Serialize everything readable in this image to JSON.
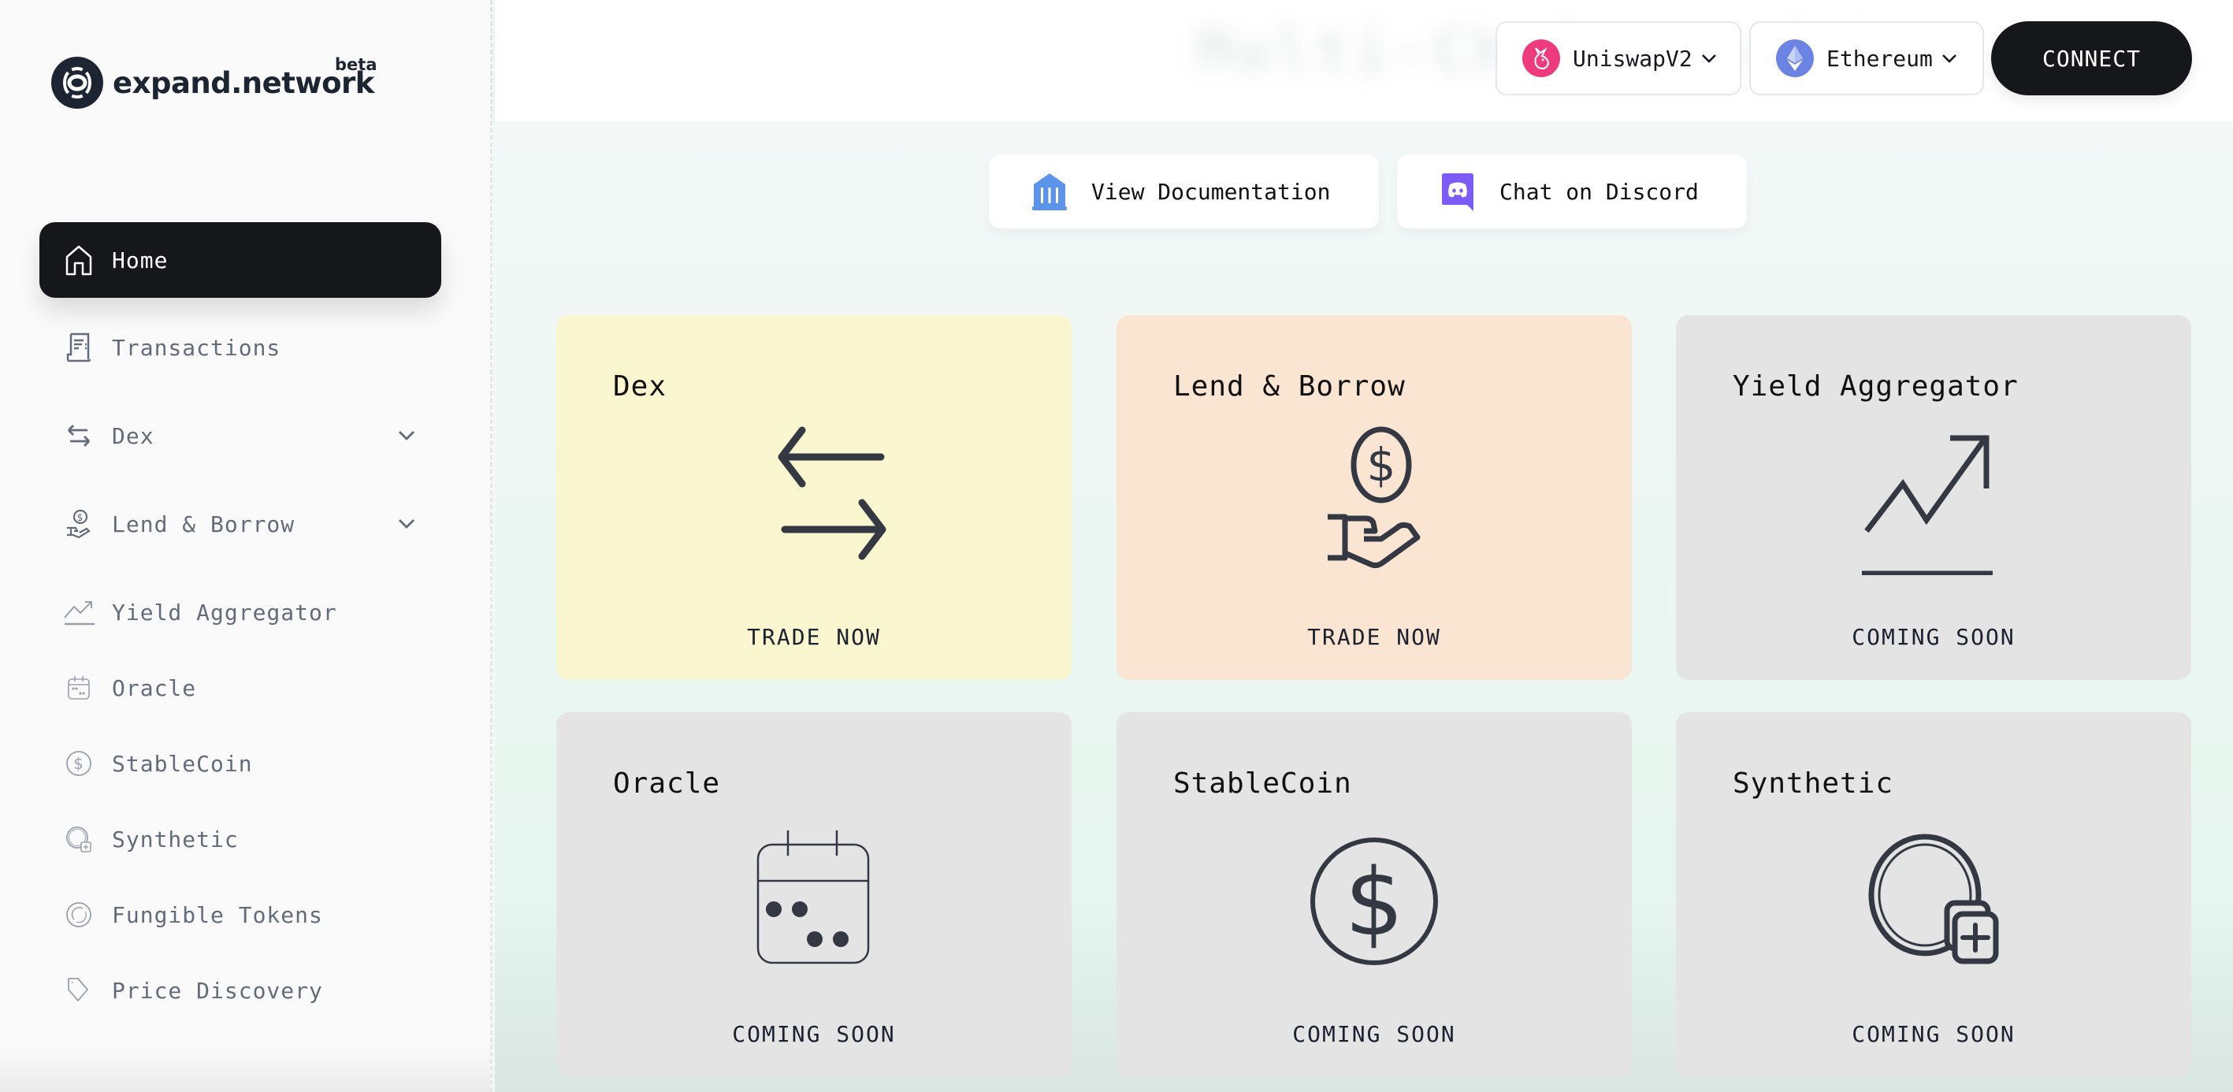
{
  "brand": {
    "name": "expand.network",
    "badge": "beta"
  },
  "sidebar": {
    "items": [
      {
        "label": "Home",
        "icon": "home-icon",
        "active": true
      },
      {
        "label": "Transactions",
        "icon": "receipt-icon"
      },
      {
        "label": "Dex",
        "icon": "swap-arrows-icon",
        "expandable": true
      },
      {
        "label": "Lend & Borrow",
        "icon": "hand-coin-icon",
        "expandable": true
      },
      {
        "label": "Yield Aggregator",
        "icon": "trend-up-icon"
      },
      {
        "label": "Oracle",
        "icon": "calendar-icon"
      },
      {
        "label": "StableCoin",
        "icon": "dollar-coin-icon"
      },
      {
        "label": "Synthetic",
        "icon": "coin-plus-icon"
      },
      {
        "label": "Fungible Tokens",
        "icon": "token-icon"
      },
      {
        "label": "Price Discovery",
        "icon": "tag-icon"
      }
    ]
  },
  "header": {
    "title_blurred": "Multi-Chain World",
    "dex_selector": {
      "value": "UniswapV2",
      "icon": "uniswap-unicorn-icon",
      "color": "#ee3b7d"
    },
    "chain_selector": {
      "value": "Ethereum",
      "icon": "ethereum-icon",
      "color": "#6b84e3"
    },
    "connect_label": "CONNECT"
  },
  "links": {
    "docs": {
      "label": "View Documentation",
      "icon": "bank-icon",
      "color": "#5b94ea"
    },
    "discord": {
      "label": "Chat on Discord",
      "icon": "discord-icon",
      "color": "#7c5af6"
    }
  },
  "cards": [
    {
      "title": "Dex",
      "cta": "TRADE NOW",
      "icon": "swap-arrows-icon",
      "bg": "#faf6d0"
    },
    {
      "title": "Lend & Borrow",
      "cta": "TRADE NOW",
      "icon": "hand-coin-icon",
      "bg": "#fae5d3"
    },
    {
      "title": "Yield Aggregator",
      "cta": "COMING SOON",
      "icon": "trend-up-icon",
      "bg": "#e4e4e4"
    },
    {
      "title": "Oracle",
      "cta": "COMING SOON",
      "icon": "calendar-icon",
      "bg": "#e4e4e4"
    },
    {
      "title": "StableCoin",
      "cta": "COMING SOON",
      "icon": "dollar-coin-icon",
      "bg": "#e4e4e4"
    },
    {
      "title": "Synthetic",
      "cta": "COMING SOON",
      "icon": "coin-plus-icon",
      "bg": "#e4e4e4"
    }
  ]
}
